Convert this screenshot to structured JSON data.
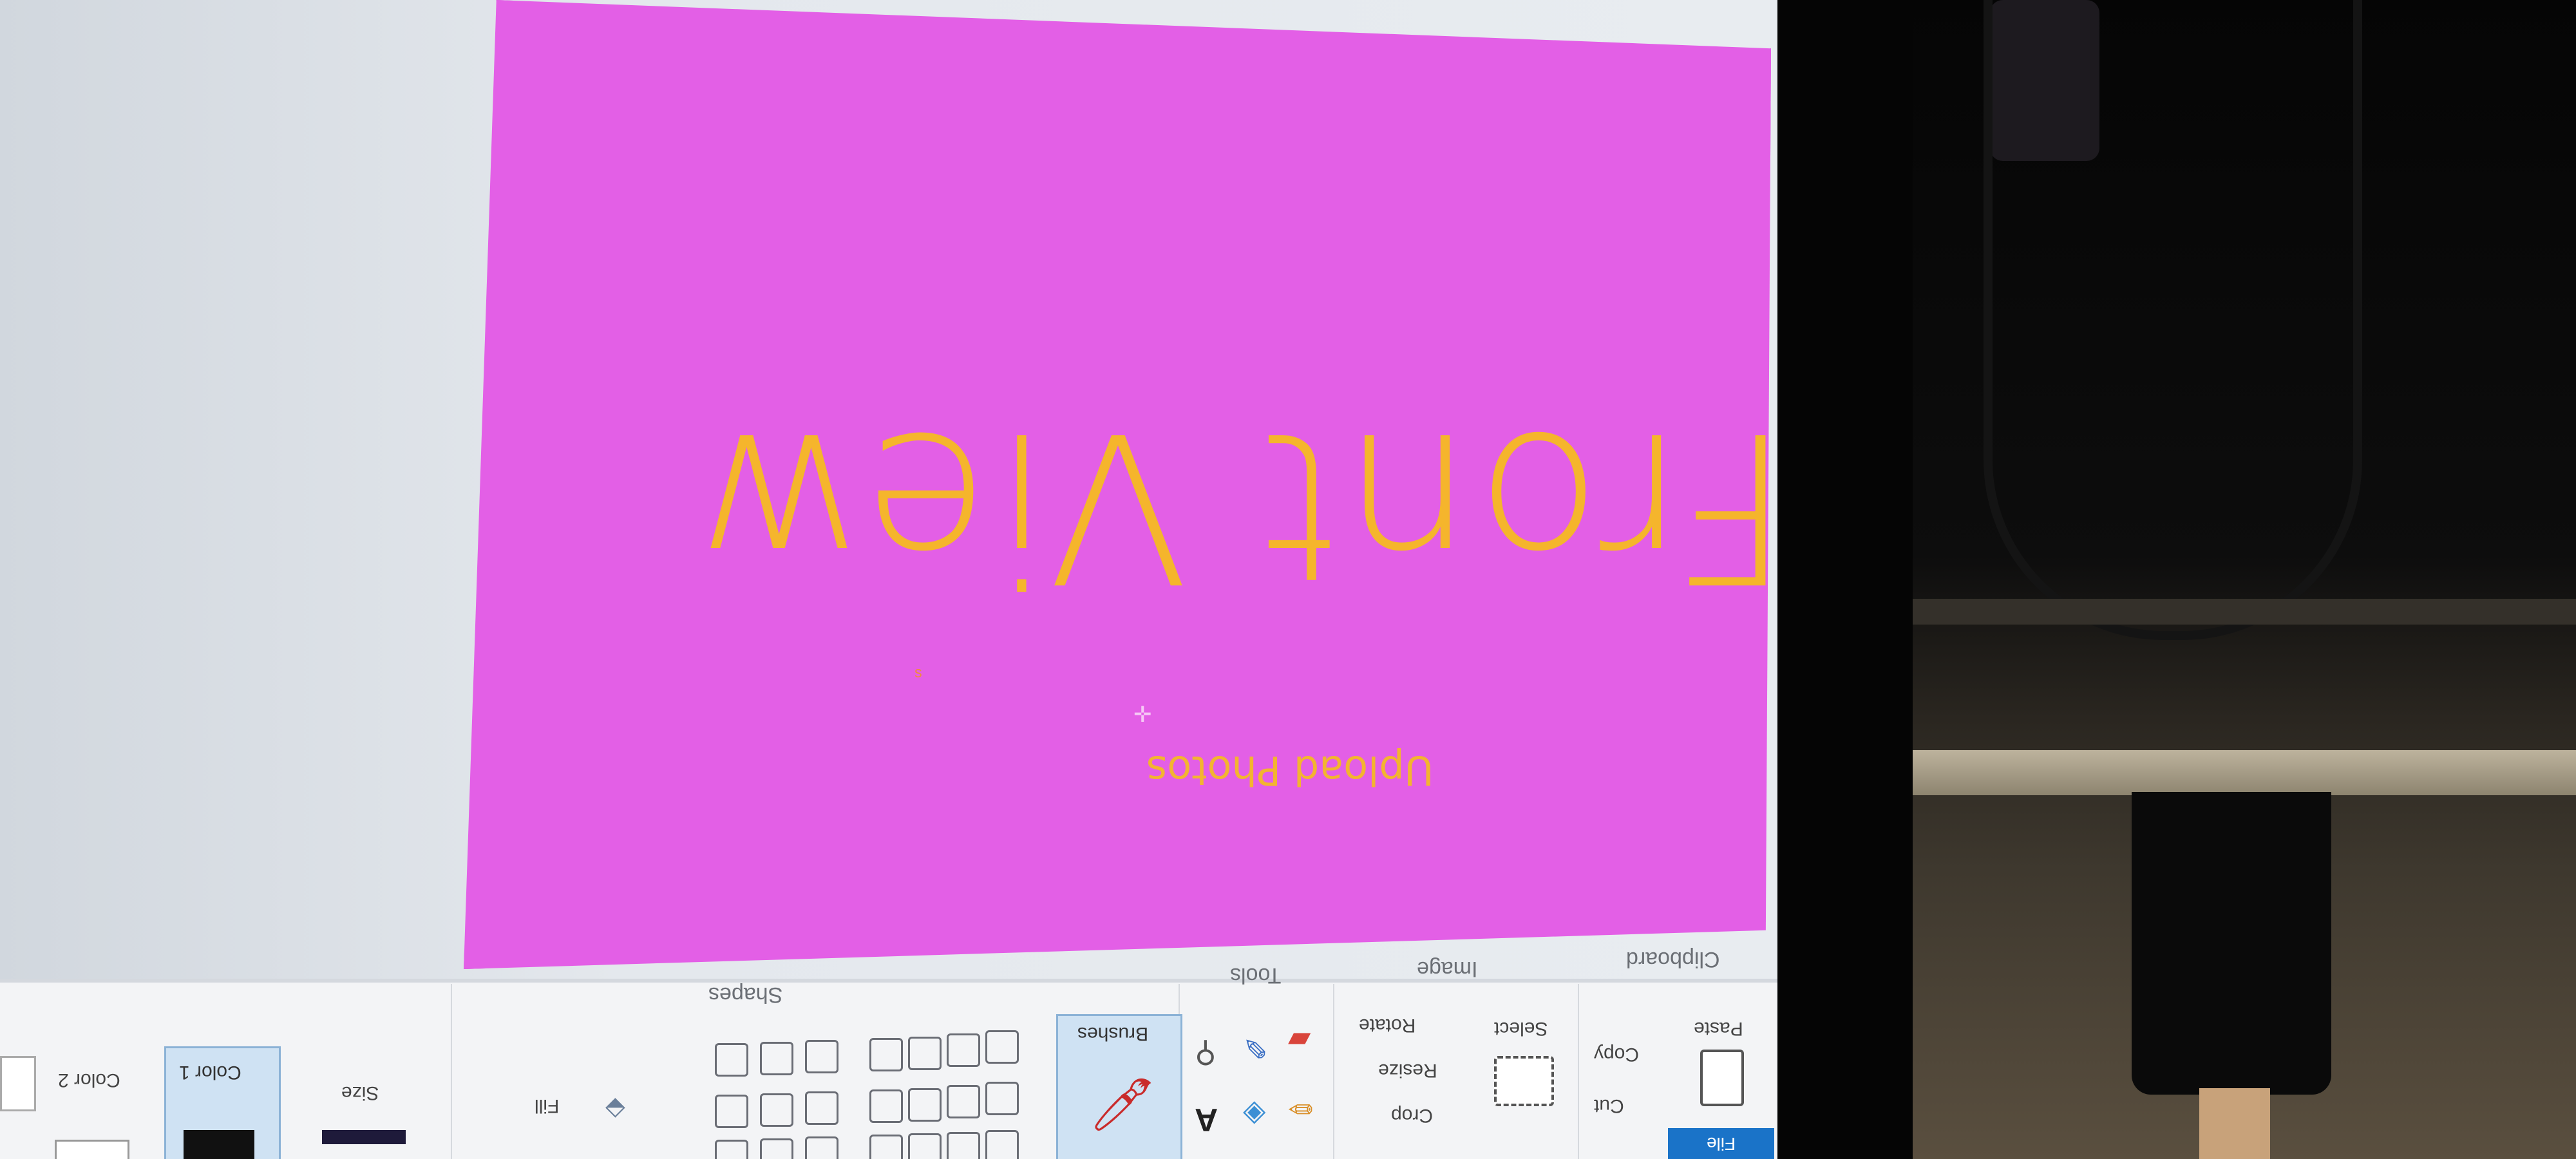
{
  "canvas": {
    "title_text": "Front View",
    "subtitle_text": "Upload Photos",
    "background_color": "#e35fe6",
    "text_color": "#f5b52c"
  },
  "ribbon": {
    "file_tab": "File",
    "groups": {
      "clipboard": "Clipboard",
      "image": "Image",
      "tools": "Tools",
      "shapes": "Shapes"
    },
    "clipboard_items": {
      "paste": "Paste",
      "cut": "Cut",
      "copy": "Copy"
    },
    "image_items": {
      "select": "Select",
      "crop": "Crop",
      "resize": "Resize",
      "rotate": "Rotate"
    },
    "brushes": "Brushes",
    "fill": "Fill",
    "size": "Size",
    "color1": "Color 1",
    "color2": "Color 2",
    "text_tool": "A"
  }
}
